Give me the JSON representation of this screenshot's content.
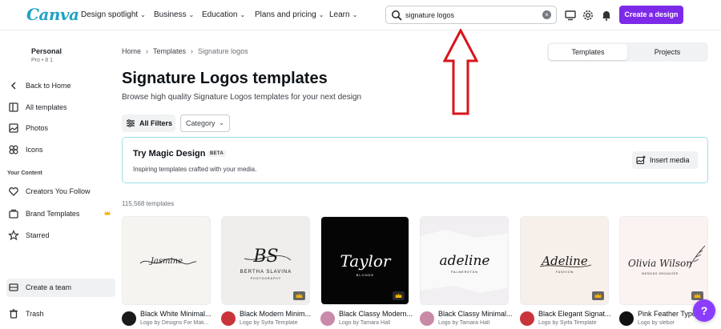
{
  "app": {
    "logo": "Canva"
  },
  "nav": [
    {
      "label": "Design spotlight"
    },
    {
      "label": "Business"
    },
    {
      "label": "Education"
    },
    {
      "label": "Plans and pricing"
    },
    {
      "label": "Learn"
    }
  ],
  "search": {
    "value": "signature logos"
  },
  "header_actions": {
    "create_label": "Create a design"
  },
  "account": {
    "name": "Personal",
    "plan": "Pro • 8 1"
  },
  "sidebar": {
    "back": "Back to Home",
    "items": [
      {
        "label": "All templates"
      },
      {
        "label": "Photos"
      },
      {
        "label": "Icons"
      }
    ],
    "section_heading": "Your Content",
    "content_items": [
      {
        "label": "Creators You Follow"
      },
      {
        "label": "Brand Templates"
      },
      {
        "label": "Starred"
      }
    ],
    "create_team": "Create a team",
    "trash": "Trash"
  },
  "breadcrumb": {
    "home": "Home",
    "templates": "Templates",
    "current": "Signature logos"
  },
  "toggle": {
    "templates": "Templates",
    "projects": "Projects"
  },
  "page": {
    "title": "Signature Logos templates",
    "subtitle": "Browse high quality Signature Logos templates for your next design"
  },
  "filters": {
    "all_filters": "All Filters",
    "category": "Category"
  },
  "magic": {
    "title": "Try Magic Design",
    "badge": "BETA",
    "desc": "Inspiring templates crafted with your media.",
    "insert_label": "Insert media"
  },
  "results": {
    "count": "115,568 templates"
  },
  "templates": [
    {
      "title": "Black White Minimal...",
      "by": "Logo by Designs For Mak...",
      "art_text": "Jasmine",
      "bg": "#f6f4f1",
      "fg": "#222222"
    },
    {
      "title": "Black Modern Minim...",
      "by": "Logo by Syifa Template",
      "art_text": "BS",
      "art_sub": "BERTHA SLAVINA",
      "art_sub2": "PHOTOGRAPHY",
      "bg": "#efeeec",
      "fg": "#1a1a1a"
    },
    {
      "title": "Black Classy Modern...",
      "by": "Logo by Tamara Hall",
      "art_text": "Taylor",
      "art_sub": "BLONDE",
      "bg": "#050505",
      "fg": "#ffffff"
    },
    {
      "title": "Black Classy Minimal...",
      "by": "Logo by Tamara Hall",
      "art_text": "adeline",
      "art_sub": "PALMERSTON",
      "bg": "#faf9fa",
      "fg": "#111111"
    },
    {
      "title": "Black Elegant Signat...",
      "by": "Logo by Syifa Template",
      "art_text": "Adeline",
      "art_sub": "FASHION",
      "bg": "#f7f0ea",
      "fg": "#1a1a1a"
    },
    {
      "title": "Pink Feather Typo...",
      "by": "Logo by slebor",
      "art_text": "Olivia Wilson",
      "art_sub": "WEDDING ORGANIZER",
      "bg": "#fbf3f1",
      "fg": "#2a2a2a"
    }
  ],
  "help": {
    "label": "?"
  },
  "annotation": {
    "color": "#d8141c"
  }
}
